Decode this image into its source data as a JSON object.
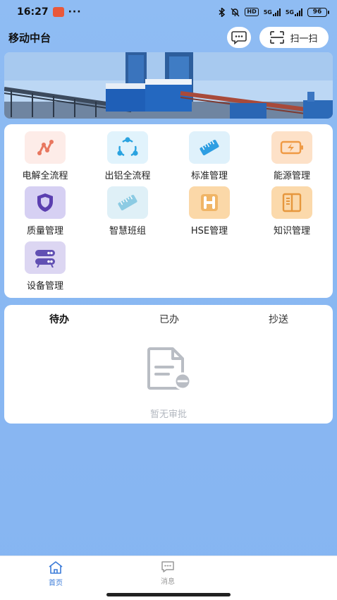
{
  "status_bar": {
    "time": "16:27",
    "dots": "···",
    "hd": "HD",
    "net1": "5G",
    "net2": "5G",
    "battery": "96"
  },
  "header": {
    "title": "移动中台",
    "scan_label": "扫一扫"
  },
  "apps": [
    {
      "label": "电解全流程",
      "icon": "route-icon",
      "color": "#e8775f",
      "bg": "#fdece8"
    },
    {
      "label": "出铝全流程",
      "icon": "share-flow-icon",
      "color": "#2aa3e0",
      "bg": "#e1f3fc"
    },
    {
      "label": "标准管理",
      "icon": "standard-card-icon",
      "color": "#2e9ee2",
      "bg": "#dff1fb"
    },
    {
      "label": "能源管理",
      "icon": "battery-bolt-icon",
      "color": "#ef9a45",
      "bg": "#fde1c8"
    },
    {
      "label": "质量管理",
      "icon": "shield-icon",
      "color": "#5b3fb0",
      "bg": "#d6d0f3"
    },
    {
      "label": "智慧班组",
      "icon": "ruler-card-icon",
      "color": "#67b7d8",
      "bg": "#dff0f7"
    },
    {
      "label": "HSE管理",
      "icon": "hse-h-icon",
      "color": "#e8a14a",
      "bg": "#fbd8a8"
    },
    {
      "label": "知识管理",
      "icon": "book-icon",
      "color": "#e6973d",
      "bg": "#fbd9ab"
    },
    {
      "label": "设备管理",
      "icon": "device-rack-icon",
      "color": "#6150b3",
      "bg": "#dcd6f2"
    }
  ],
  "approval": {
    "tabs": [
      "待办",
      "已办",
      "抄送"
    ],
    "active_tab": "待办",
    "empty_text": "暂无审批"
  },
  "bottom_nav": {
    "items": [
      {
        "label": "首页",
        "icon": "home-icon",
        "active": true
      },
      {
        "label": "消息",
        "icon": "message-icon",
        "active": false
      }
    ],
    "active_color": "#3b7bd8",
    "inactive_color": "#999999"
  }
}
